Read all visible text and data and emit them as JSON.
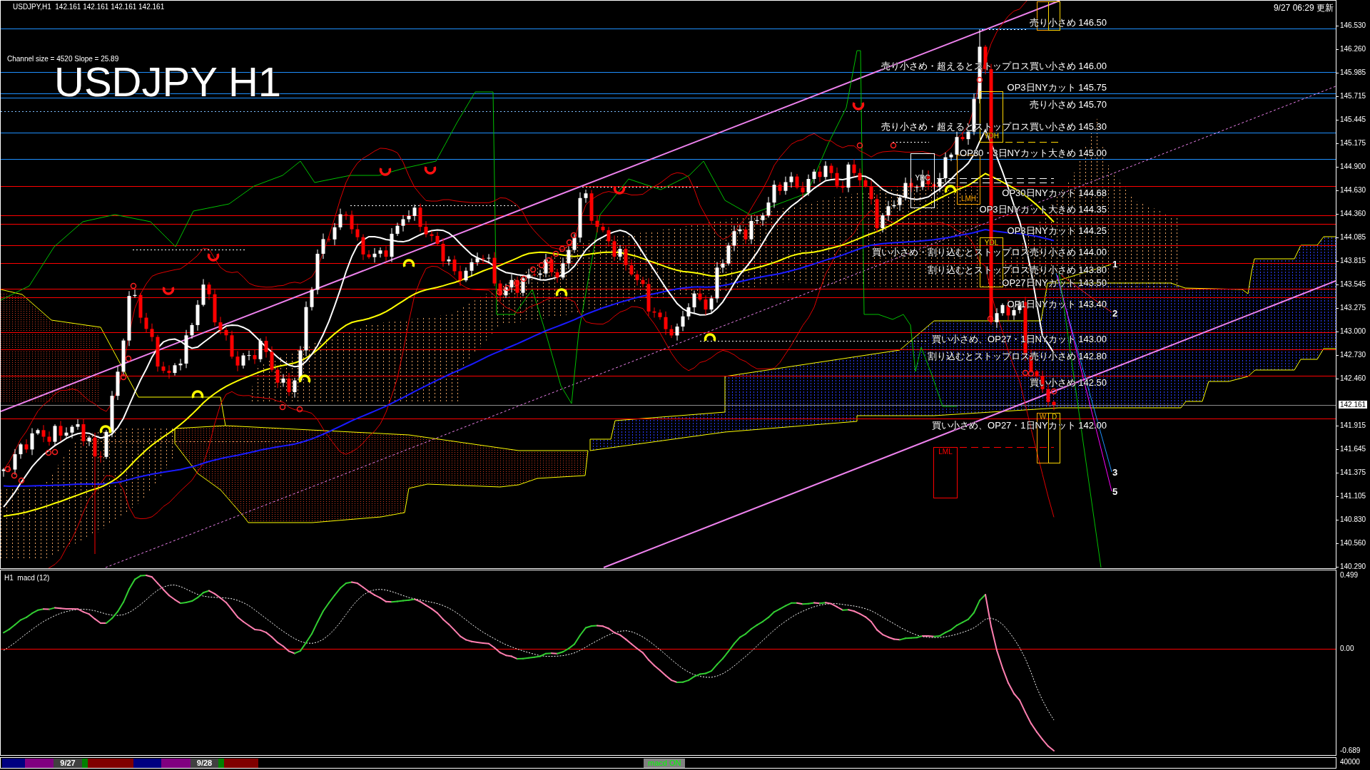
{
  "header": "USDJPY,H1  142.161 142.161 142.161 142.161",
  "updated": "9/27 06:29 更新",
  "channel_info": "Channel size = 4520 Slope = 25.89",
  "title": "USDJPY H1",
  "levels": [
    {
      "text": "売り小さめ 146.50",
      "kind": "resistance",
      "color": "#1e90ff"
    },
    {
      "text": "売り小さめ・超えるとストップロス買い小さめ 146.00",
      "kind": "resistance",
      "color": "#1e90ff"
    },
    {
      "text": "OP3日NYカット 145.75",
      "kind": "resistance",
      "color": "#1e90ff"
    },
    {
      "text": "売り小さめ 145.70",
      "kind": "resistance",
      "color": "#1e90ff"
    },
    {
      "text": "売り小さめ・超えるとストップロス買い小さめ 145.30",
      "kind": "resistance",
      "color": "#1e90ff"
    },
    {
      "text": "OP30・3日NYカット大きめ 145.00",
      "kind": "resistance",
      "color": "#1e90ff"
    },
    {
      "text": "OP30日NYカット 144.68",
      "kind": "support",
      "color": "#ff0000"
    },
    {
      "text": "OP3日NYカット大きめ 144.35",
      "kind": "support",
      "color": "#ff0000"
    },
    {
      "text": "OP3日NYカット 144.25",
      "kind": "support",
      "color": "#ff0000"
    },
    {
      "text": "買い小さめ・割り込むとストップロス売り小さめ 144.00",
      "kind": "support",
      "color": "#ff0000"
    },
    {
      "text": "割り込むとストップロス売り小さめ 143.80",
      "kind": "support",
      "color": "#ff0000"
    },
    {
      "text": "OP27日NYカット 143.50",
      "kind": "support",
      "color": "#ff0000"
    },
    {
      "text": "OP1日NYカット 143.40",
      "kind": "support",
      "color": "#ff0000"
    },
    {
      "text": "買い小さめ、OP27・1日NYカット 143.00",
      "kind": "support",
      "color": "#ff0000"
    },
    {
      "text": "割り込むとストップロス売り小さめ 142.80",
      "kind": "support",
      "color": "#ff0000"
    },
    {
      "text": "買い小さめ 142.50",
      "kind": "support",
      "color": "#ff0000"
    },
    {
      "text": "買い小さめ、OP27・1日NYカット 142.00",
      "kind": "support",
      "color": "#ff0000"
    }
  ],
  "boxes": [
    {
      "color": "#ffa500"
    },
    {
      "color": "#ffd700"
    },
    {
      "label": "YDH",
      "color": "#ffd700"
    },
    {
      "label": "YDC",
      "color": "#ffffff"
    },
    {
      "label": "LMH",
      "color": "#ffa500"
    },
    {
      "label": "YDL",
      "color": "#ffd700"
    },
    {
      "label": "W",
      "color": "#ffa500"
    },
    {
      "label": "D",
      "color": "#ffd700"
    },
    {
      "label": "LML",
      "color": "#ff0000"
    }
  ],
  "fan_labels": [
    "1",
    "2",
    "3",
    "5"
  ],
  "price_axis": [
    "146.530",
    "146.260",
    "145.985",
    "145.715",
    "145.445",
    "145.175",
    "144.900",
    "144.630",
    "144.360",
    "144.085",
    "143.815",
    "143.545",
    "143.275",
    "143.000",
    "142.730",
    "142.460",
    "141.915",
    "141.645",
    "141.375",
    "141.105",
    "140.830",
    "140.560",
    "140.290"
  ],
  "current_price": "142.161",
  "macd_panel": {
    "label": "H1  macd (12)",
    "axis": [
      "0.499",
      "0.00",
      "-0.689"
    ]
  },
  "volume_axis": "40000",
  "sessions": [
    {
      "color": "#000080"
    },
    {
      "color": "#800080"
    },
    {
      "color": "#404040",
      "label": "9/27"
    },
    {
      "color": "#008000"
    },
    {
      "color": "#800000"
    },
    {
      "color": "#000080"
    },
    {
      "color": "#800080"
    },
    {
      "color": "#404040",
      "label": "9/28"
    },
    {
      "color": "#008000"
    },
    {
      "color": "#800000"
    }
  ],
  "macd_button": "macd ON"
}
